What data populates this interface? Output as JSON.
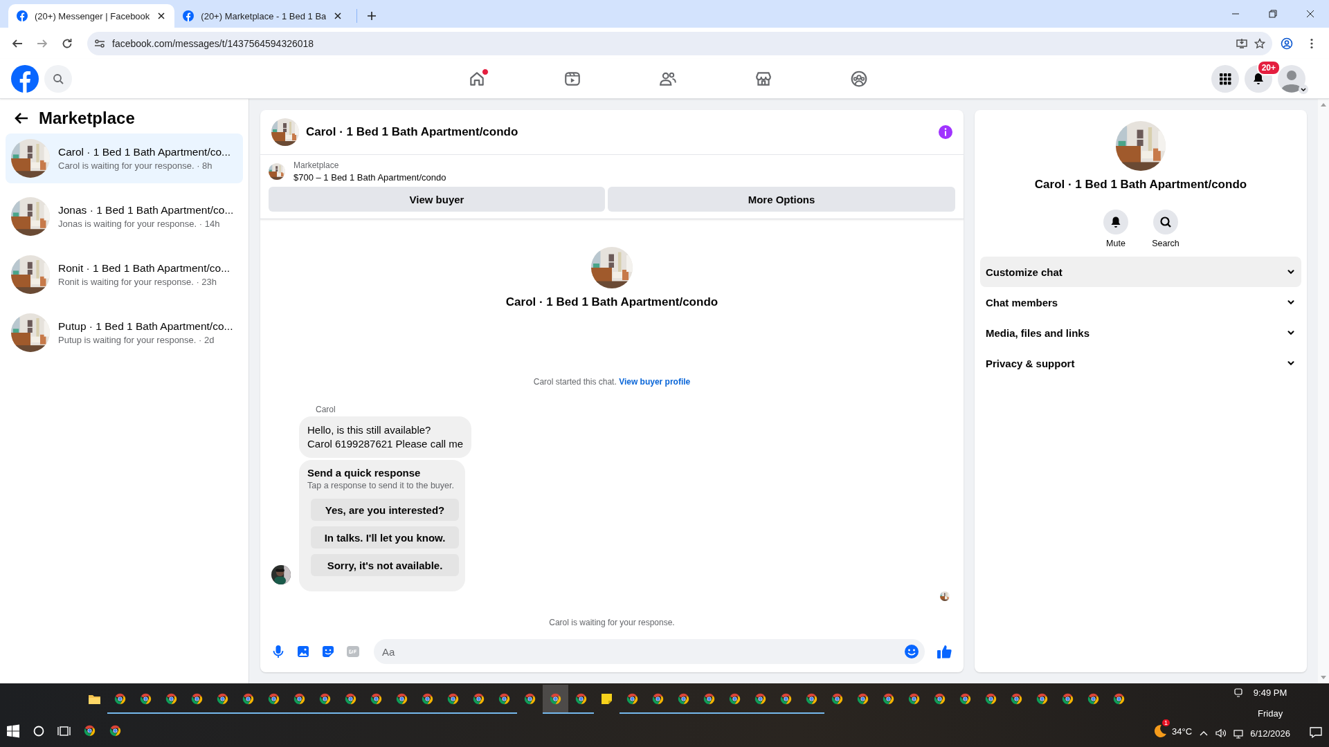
{
  "browser": {
    "tabs": [
      {
        "title": "(20+) Messenger | Facebook",
        "selected": true
      },
      {
        "title": "(20+) Marketplace - 1 Bed 1 Ba",
        "selected": false
      }
    ],
    "url": "facebook.com/messages/t/1437564594326018"
  },
  "nav": {
    "items": [
      {
        "kind": "home",
        "dot": true
      },
      {
        "kind": "video",
        "dot": false
      },
      {
        "kind": "friends",
        "dot": false
      },
      {
        "kind": "store",
        "dot": false
      },
      {
        "kind": "groups",
        "dot": false
      }
    ],
    "notification_badge": "20+"
  },
  "sidebar": {
    "title": "Marketplace",
    "chats": [
      {
        "title": "Carol · 1 Bed 1 Bath Apartment/co...",
        "preview": "Carol is waiting for your response. · 8h",
        "selected": true
      },
      {
        "title": "Jonas · 1 Bed 1 Bath Apartment/co...",
        "preview": "Jonas is waiting for your response. · 14h",
        "selected": false
      },
      {
        "title": "Ronit · 1 Bed 1 Bath Apartment/co...",
        "preview": "Ronit is waiting for your response. · 23h",
        "selected": false
      },
      {
        "title": "Putup · 1 Bed 1 Bath Apartment/co...",
        "preview": "Putup is waiting for your response. · 2d",
        "selected": false
      }
    ]
  },
  "chat": {
    "title": "Carol · 1 Bed 1 Bath Apartment/condo",
    "listing": {
      "source": "Marketplace",
      "summary": "$700 – 1 Bed 1 Bath Apartment/condo"
    },
    "actions": [
      "View buyer",
      "More Options"
    ],
    "intro_name": "Carol · 1 Bed 1 Bath Apartment/condo",
    "started": {
      "text": "Carol started this chat.",
      "link": "View buyer profile"
    },
    "sender": "Carol",
    "message_lines": [
      "Hello, is this still available?",
      "Carol 6199287621 Please call me"
    ],
    "quick": {
      "title": "Send a quick response",
      "hint": "Tap a response to send it to the buyer.",
      "options": [
        "Yes, are you interested?",
        "In talks. I'll let you know.",
        "Sorry, it's not available."
      ]
    },
    "status": "Carol is waiting for your response.",
    "composer": {
      "placeholder": "Aa"
    }
  },
  "details": {
    "name": "Carol · 1 Bed 1 Bath Apartment/condo",
    "actions": [
      {
        "kind": "mute",
        "label": "Mute"
      },
      {
        "kind": "search",
        "label": "Search"
      }
    ],
    "sections": [
      {
        "label": "Customize chat",
        "selected": true
      },
      {
        "label": "Chat members",
        "selected": false
      },
      {
        "label": "Media, files and links",
        "selected": false
      },
      {
        "label": "Privacy & support",
        "selected": false
      }
    ]
  },
  "taskbar": {
    "apps": [
      {
        "kind": "folder",
        "running": false,
        "selected": false
      },
      {
        "kind": "chrome",
        "running": true,
        "selected": false
      },
      {
        "kind": "chrome",
        "running": true,
        "selected": false
      },
      {
        "kind": "chrome",
        "running": true,
        "selected": false
      },
      {
        "kind": "chrome",
        "running": true,
        "selected": false
      },
      {
        "kind": "chrome",
        "running": true,
        "selected": false
      },
      {
        "kind": "chrome",
        "running": true,
        "selected": false
      },
      {
        "kind": "chrome",
        "running": true,
        "selected": false
      },
      {
        "kind": "chrome",
        "running": true,
        "selected": false
      },
      {
        "kind": "chrome",
        "running": true,
        "selected": false
      },
      {
        "kind": "chrome",
        "running": true,
        "selected": false
      },
      {
        "kind": "chrome",
        "running": true,
        "selected": false
      },
      {
        "kind": "chrome",
        "running": true,
        "selected": false
      },
      {
        "kind": "chrome",
        "running": true,
        "selected": false
      },
      {
        "kind": "chrome",
        "running": true,
        "selected": false
      },
      {
        "kind": "chrome",
        "running": true,
        "selected": false
      },
      {
        "kind": "chrome",
        "running": true,
        "selected": false
      },
      {
        "kind": "chrome",
        "running": false,
        "selected": false
      },
      {
        "kind": "chrome",
        "running": true,
        "selected": true
      },
      {
        "kind": "chrome",
        "running": true,
        "selected": false
      },
      {
        "kind": "notes",
        "running": false,
        "selected": false
      },
      {
        "kind": "chrome",
        "running": true,
        "selected": false
      },
      {
        "kind": "chrome",
        "running": true,
        "selected": false
      },
      {
        "kind": "chrome",
        "running": true,
        "selected": false
      },
      {
        "kind": "chrome",
        "running": true,
        "selected": false
      },
      {
        "kind": "chrome",
        "running": true,
        "selected": false
      },
      {
        "kind": "chrome",
        "running": true,
        "selected": false
      },
      {
        "kind": "chrome",
        "running": true,
        "selected": false
      },
      {
        "kind": "chrome",
        "running": true,
        "selected": false
      },
      {
        "kind": "chrome",
        "running": false,
        "selected": false
      },
      {
        "kind": "chrome",
        "running": false,
        "selected": false
      },
      {
        "kind": "chrome",
        "running": false,
        "selected": false
      },
      {
        "kind": "chrome",
        "running": false,
        "selected": false
      },
      {
        "kind": "chrome",
        "running": false,
        "selected": false
      },
      {
        "kind": "chrome",
        "running": false,
        "selected": false
      },
      {
        "kind": "chrome",
        "running": false,
        "selected": false
      },
      {
        "kind": "chrome",
        "running": false,
        "selected": false
      },
      {
        "kind": "chrome",
        "running": false,
        "selected": false
      },
      {
        "kind": "chrome",
        "running": false,
        "selected": false
      },
      {
        "kind": "chrome",
        "running": false,
        "selected": false
      },
      {
        "kind": "chrome",
        "running": false,
        "selected": false
      }
    ],
    "pinned": [
      {
        "kind": "chrome"
      },
      {
        "kind": "chrome"
      }
    ],
    "weather": "34°C",
    "weather_badge": "1",
    "time": "9:49 PM",
    "day": "Friday",
    "date": "6/12/2026"
  }
}
